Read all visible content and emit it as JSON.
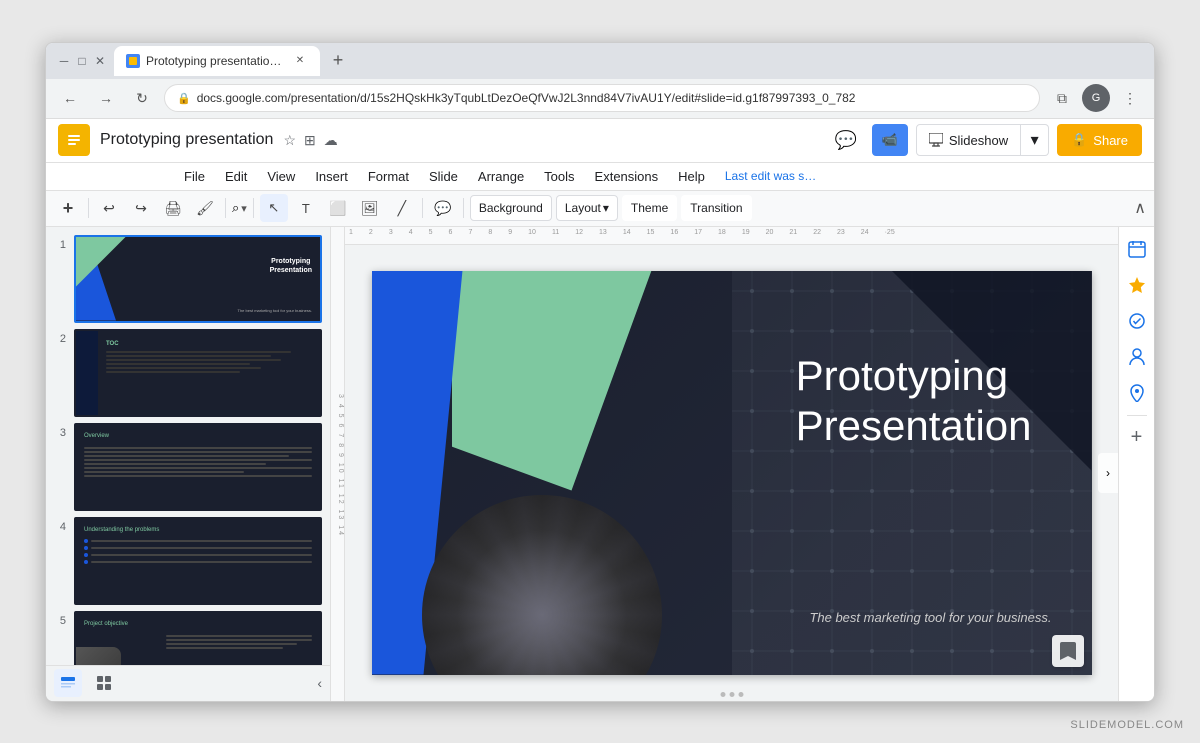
{
  "browser": {
    "tab_title": "Prototyping presentation - Goo…",
    "url": "docs.google.com/presentation/d/15s2HQskHk3yTqubLtDezOeQfVwJ2L3nnd84V7ivAU1Y/edit#slide=id.g1f87997393_0_782",
    "new_tab_label": "+",
    "back_btn": "←",
    "forward_btn": "→",
    "refresh_btn": "↻",
    "lock_icon": "🔒",
    "guest_label": "Guest",
    "extensions_icon": "⧉"
  },
  "app": {
    "title": "Prototyping presentation",
    "doc_icon": "📊",
    "star_icon": "☆",
    "save_icon": "💾",
    "cloud_icon": "☁",
    "comment_icon": "💬",
    "meet_icon": "📹",
    "slideshow_label": "Slideshow",
    "slideshow_dropdown": "▾",
    "share_label": "🔒 Share",
    "last_edit": "Last edit was s…"
  },
  "menu": {
    "items": [
      "File",
      "Edit",
      "View",
      "Insert",
      "Format",
      "Slide",
      "Arrange",
      "Tools",
      "Extensions",
      "Help"
    ]
  },
  "toolbar": {
    "background_label": "Background",
    "layout_label": "Layout",
    "theme_label": "Theme",
    "transition_label": "Transition",
    "zoom_label": "⌕",
    "collapse_icon": "∧"
  },
  "slides": [
    {
      "num": "1",
      "title": "Prototyping Presentation",
      "subtitle": "The best marketing tool for your business."
    },
    {
      "num": "2",
      "title": "TOC"
    },
    {
      "num": "3",
      "title": "Overview"
    },
    {
      "num": "4",
      "title": "Understanding the problems"
    },
    {
      "num": "5",
      "title": "Project objective"
    }
  ],
  "main_slide": {
    "title_line1": "Prototyping",
    "title_line2": "Presentation",
    "subtitle": "The best marketing tool for your business."
  },
  "right_panel": {
    "calendar_icon": "📅",
    "star_icon": "★",
    "check_icon": "✓",
    "person_icon": "👤",
    "location_icon": "📍",
    "add_icon": "+",
    "nav_icon": "›"
  },
  "bottom": {
    "list_view_icon": "☰",
    "grid_view_icon": "⊞",
    "collapse_icon": "‹",
    "presenter_dots": [
      "•",
      "•",
      "•"
    ]
  },
  "watermark": "SLIDEMODEL.COM"
}
